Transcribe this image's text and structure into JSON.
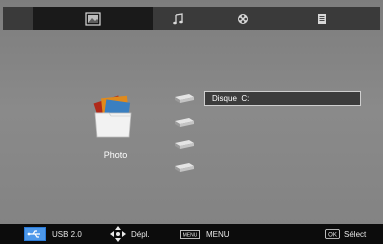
{
  "tabs": [
    {
      "icon": "photo-icon",
      "selected": true
    },
    {
      "icon": "music-note-icon",
      "selected": false
    },
    {
      "icon": "film-reel-icon",
      "selected": false
    },
    {
      "icon": "text-document-icon",
      "selected": false
    }
  ],
  "category": {
    "label": "Photo",
    "icon": "photo-folder-icon"
  },
  "drives": {
    "count": 4,
    "icon": "hard-drive-icon",
    "selected_label": "Disque  C:"
  },
  "bottom_bar": {
    "usb_label": "USB 2.0",
    "move_label": "Dépl.",
    "menu_key_text": "MENU",
    "menu_label": "MENU",
    "ok_key_text": "OK",
    "select_label": "Sélect"
  },
  "colors": {
    "background": "#828282",
    "tabbar": "#3a3a3a",
    "selected_tab": "#1a1a1a",
    "bottom_bar": "#0c0c0c",
    "selection_box": "#3c3c3c"
  }
}
